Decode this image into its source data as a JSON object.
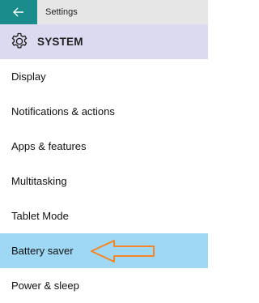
{
  "titlebar": {
    "back_icon": "back-arrow-icon",
    "app_title": "Settings",
    "accent_color": "#1a8c8c"
  },
  "header": {
    "icon": "gear-icon",
    "title": "SYSTEM"
  },
  "nav": {
    "items": [
      {
        "label": "Display",
        "selected": false
      },
      {
        "label": "Notifications & actions",
        "selected": false
      },
      {
        "label": "Apps & features",
        "selected": false
      },
      {
        "label": "Multitasking",
        "selected": false
      },
      {
        "label": "Tablet Mode",
        "selected": false
      },
      {
        "label": "Battery saver",
        "selected": true
      },
      {
        "label": "Power & sleep",
        "selected": false
      }
    ],
    "selected_color": "#9fd8f4"
  },
  "annotation": {
    "icon": "callout-arrow-icon",
    "color": "#f5872a"
  }
}
